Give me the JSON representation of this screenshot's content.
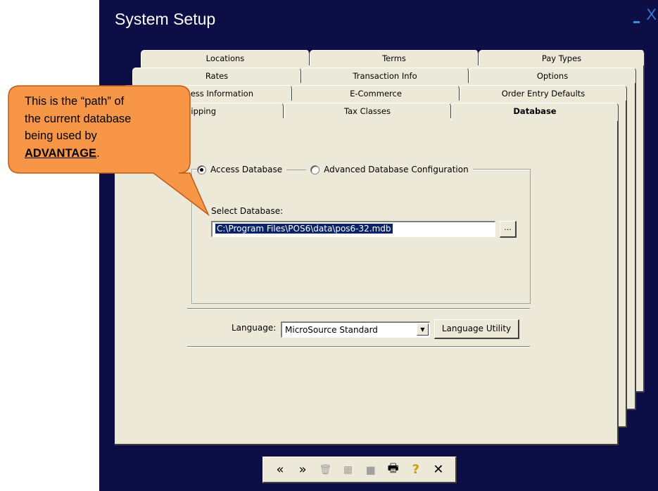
{
  "window": {
    "title": "System Setup",
    "minimize_glyph": "_",
    "close_glyph": "X"
  },
  "tabs": {
    "row1": [
      "Locations",
      "Terms",
      "Pay Types"
    ],
    "row2": [
      "Rates",
      "Transaction Info",
      "Options"
    ],
    "row3": [
      "ess Information",
      "E-Commerce",
      "Order Entry Defaults"
    ],
    "row4": [
      "ipping",
      "Tax Classes",
      "Database"
    ]
  },
  "database": {
    "radio_access": "Access Database",
    "radio_advanced": "Advanced Database Configuration",
    "select_label": "Select Database:",
    "path_value": "C:\\Program Files\\POS6\\data\\pos6-32.mdb",
    "browse_label": "..."
  },
  "language": {
    "label": "Language:",
    "value": "MicroSource Standard",
    "utility_button": "Language Utility"
  },
  "toolbar": {
    "icons": [
      "first-icon",
      "next-icon",
      "delete-icon",
      "folder-icon",
      "save-icon",
      "print-icon",
      "help-icon",
      "close-icon"
    ],
    "glyphs": {
      "first": "«",
      "next": "»",
      "delete": "🗑",
      "folder": "▦",
      "save": "■",
      "print": "🖶",
      "help": "?",
      "close": "✕"
    }
  },
  "callout": {
    "line1": "This is the “path” of",
    "line2": "the current database",
    "line3": "being used by",
    "brand": "ADVANTAGE",
    "suffix": "."
  },
  "colors": {
    "window_bg": "#0e0e46",
    "panel_bg": "#ece9d8",
    "callout_fill": "#f79646",
    "callout_stroke": "#c05a14",
    "selection": "#0a246a"
  }
}
